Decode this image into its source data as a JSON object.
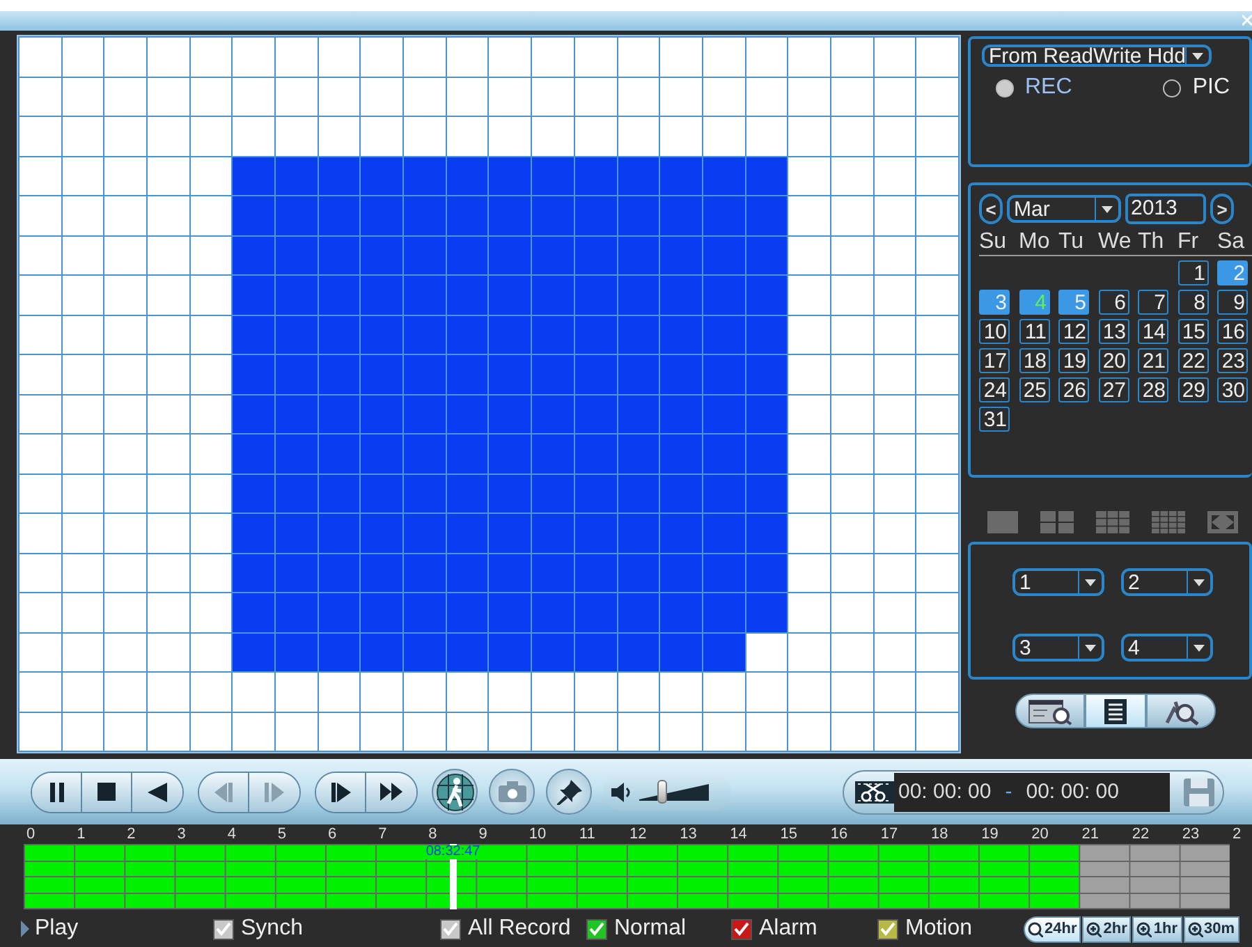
{
  "grid": {
    "rows": [
      {
        "selected": [
          false,
          false,
          false,
          false,
          false,
          false,
          false,
          false,
          false,
          false,
          false,
          false,
          false,
          false,
          false,
          false,
          false,
          false,
          false,
          false,
          false,
          false
        ]
      },
      {
        "selected": [
          false,
          false,
          false,
          false,
          false,
          false,
          false,
          false,
          false,
          false,
          false,
          false,
          false,
          false,
          false,
          false,
          false,
          false,
          false,
          false,
          false,
          false
        ]
      },
      {
        "selected": [
          false,
          false,
          false,
          false,
          false,
          false,
          false,
          false,
          false,
          false,
          false,
          false,
          false,
          false,
          false,
          false,
          false,
          false,
          false,
          false,
          false,
          false
        ]
      },
      {
        "selected": [
          false,
          false,
          false,
          false,
          false,
          true,
          true,
          true,
          true,
          true,
          true,
          true,
          true,
          true,
          true,
          true,
          true,
          true,
          false,
          false,
          false,
          false
        ]
      },
      {
        "selected": [
          false,
          false,
          false,
          false,
          false,
          true,
          true,
          true,
          true,
          true,
          true,
          true,
          true,
          true,
          true,
          true,
          true,
          true,
          false,
          false,
          false,
          false
        ]
      },
      {
        "selected": [
          false,
          false,
          false,
          false,
          false,
          true,
          true,
          true,
          true,
          true,
          true,
          true,
          true,
          true,
          true,
          true,
          true,
          true,
          false,
          false,
          false,
          false
        ]
      },
      {
        "selected": [
          false,
          false,
          false,
          false,
          false,
          true,
          true,
          true,
          true,
          true,
          true,
          true,
          true,
          true,
          true,
          true,
          true,
          true,
          false,
          false,
          false,
          false
        ]
      },
      {
        "selected": [
          false,
          false,
          false,
          false,
          false,
          true,
          true,
          true,
          true,
          true,
          true,
          true,
          true,
          true,
          true,
          true,
          true,
          true,
          false,
          false,
          false,
          false
        ]
      },
      {
        "selected": [
          false,
          false,
          false,
          false,
          false,
          true,
          true,
          true,
          true,
          true,
          true,
          true,
          true,
          true,
          true,
          true,
          true,
          true,
          false,
          false,
          false,
          false
        ]
      },
      {
        "selected": [
          false,
          false,
          false,
          false,
          false,
          true,
          true,
          true,
          true,
          true,
          true,
          true,
          true,
          true,
          true,
          true,
          true,
          true,
          false,
          false,
          false,
          false
        ]
      },
      {
        "selected": [
          false,
          false,
          false,
          false,
          false,
          true,
          true,
          true,
          true,
          true,
          true,
          true,
          true,
          true,
          true,
          true,
          true,
          true,
          false,
          false,
          false,
          false
        ]
      },
      {
        "selected": [
          false,
          false,
          false,
          false,
          false,
          true,
          true,
          true,
          true,
          true,
          true,
          true,
          true,
          true,
          true,
          true,
          true,
          true,
          false,
          false,
          false,
          false
        ]
      },
      {
        "selected": [
          false,
          false,
          false,
          false,
          false,
          true,
          true,
          true,
          true,
          true,
          true,
          true,
          true,
          true,
          true,
          true,
          true,
          true,
          false,
          false,
          false,
          false
        ]
      },
      {
        "selected": [
          false,
          false,
          false,
          false,
          false,
          true,
          true,
          true,
          true,
          true,
          true,
          true,
          true,
          true,
          true,
          true,
          true,
          true,
          false,
          false,
          false,
          false
        ]
      },
      {
        "selected": [
          false,
          false,
          false,
          false,
          false,
          true,
          true,
          true,
          true,
          true,
          true,
          true,
          true,
          true,
          true,
          true,
          true,
          true,
          false,
          false,
          false,
          false
        ]
      },
      {
        "selected": [
          false,
          false,
          false,
          false,
          false,
          true,
          true,
          true,
          true,
          true,
          true,
          true,
          true,
          true,
          true,
          true,
          true,
          false,
          false,
          false,
          false,
          false
        ]
      },
      {
        "selected": [
          false,
          false,
          false,
          false,
          false,
          false,
          false,
          false,
          false,
          false,
          false,
          false,
          false,
          false,
          false,
          false,
          false,
          false,
          false,
          false,
          false,
          false
        ]
      },
      {
        "selected": [
          false,
          false,
          false,
          false,
          false,
          false,
          false,
          false,
          false,
          false,
          false,
          false,
          false,
          false,
          false,
          false,
          false,
          false,
          false,
          false,
          false,
          false
        ]
      }
    ]
  },
  "source": {
    "dropdown": "From ReadWrite Hdd",
    "options": [
      {
        "label": "REC",
        "selected": true
      },
      {
        "label": "PIC",
        "selected": false
      }
    ]
  },
  "calendar": {
    "prev": "<",
    "month": "Mar",
    "year": "2013",
    "next": ">",
    "weekdays": [
      "Su",
      "Mo",
      "Tu",
      "We",
      "Th",
      "Fr",
      "Sa"
    ],
    "weeks": [
      [
        {
          "kind": "blank"
        },
        {
          "kind": "blank"
        },
        {
          "kind": "blank"
        },
        {
          "kind": "blank"
        },
        {
          "kind": "blank"
        },
        {
          "label": "1",
          "has_record": false,
          "today": false
        },
        {
          "label": "2",
          "has_record": true,
          "today": false
        }
      ],
      [
        {
          "label": "3",
          "has_record": true,
          "today": false
        },
        {
          "label": "4",
          "has_record": true,
          "today": true
        },
        {
          "label": "5",
          "has_record": true,
          "today": false
        },
        {
          "label": "6",
          "has_record": false,
          "today": false
        },
        {
          "label": "7",
          "has_record": false,
          "today": false
        },
        {
          "label": "8",
          "has_record": false,
          "today": false
        },
        {
          "label": "9",
          "has_record": false,
          "today": false
        }
      ],
      [
        {
          "label": "10",
          "has_record": false,
          "today": false
        },
        {
          "label": "11",
          "has_record": false,
          "today": false
        },
        {
          "label": "12",
          "has_record": false,
          "today": false
        },
        {
          "label": "13",
          "has_record": false,
          "today": false
        },
        {
          "label": "14",
          "has_record": false,
          "today": false
        },
        {
          "label": "15",
          "has_record": false,
          "today": false
        },
        {
          "label": "16",
          "has_record": false,
          "today": false
        }
      ],
      [
        {
          "label": "17",
          "has_record": false,
          "today": false
        },
        {
          "label": "18",
          "has_record": false,
          "today": false
        },
        {
          "label": "19",
          "has_record": false,
          "today": false
        },
        {
          "label": "20",
          "has_record": false,
          "today": false
        },
        {
          "label": "21",
          "has_record": false,
          "today": false
        },
        {
          "label": "22",
          "has_record": false,
          "today": false
        },
        {
          "label": "23",
          "has_record": false,
          "today": false
        }
      ],
      [
        {
          "label": "24",
          "has_record": false,
          "today": false
        },
        {
          "label": "25",
          "has_record": false,
          "today": false
        },
        {
          "label": "26",
          "has_record": false,
          "today": false
        },
        {
          "label": "27",
          "has_record": false,
          "today": false
        },
        {
          "label": "28",
          "has_record": false,
          "today": false
        },
        {
          "label": "29",
          "has_record": false,
          "today": false
        },
        {
          "label": "30",
          "has_record": false,
          "today": false
        }
      ],
      [
        {
          "label": "31",
          "has_record": false,
          "today": false
        }
      ]
    ]
  },
  "channel_selects": [
    "1",
    "2",
    "3",
    "4"
  ],
  "tool_buttons": [
    {
      "kind": "card-search",
      "selected": false
    },
    {
      "kind": "list",
      "selected": true
    },
    {
      "kind": "smart-search",
      "selected": false
    }
  ],
  "button_groups": [
    [
      {
        "kind": "pause",
        "disabled": false
      },
      {
        "kind": "stop",
        "disabled": false
      },
      {
        "kind": "reverse",
        "disabled": false
      }
    ],
    [
      {
        "kind": "step-back",
        "disabled": true
      },
      {
        "kind": "step-forward",
        "disabled": true
      }
    ],
    [
      {
        "kind": "slow-play",
        "disabled": false
      },
      {
        "kind": "fast-forward",
        "disabled": false
      }
    ]
  ],
  "round_buttons": [
    {
      "kind": "person-grid"
    },
    {
      "kind": "camera"
    },
    {
      "kind": "pin"
    }
  ],
  "volume": {
    "level": 0.32
  },
  "clip": {
    "start": "00: 00: 00",
    "separator": "-",
    "end": "00: 00: 00"
  },
  "timeline": {
    "hours": [
      "0",
      "1",
      "2",
      "3",
      "4",
      "5",
      "6",
      "7",
      "8",
      "9",
      "10",
      "11",
      "12",
      "13",
      "14",
      "15",
      "16",
      "17",
      "18",
      "19",
      "20",
      "21",
      "22",
      "23",
      "2"
    ],
    "playhead": {
      "time": "08:32:47",
      "level": 0.356
    },
    "channels": [
      {
        "level": 0.875
      },
      {
        "level": 0.875
      },
      {
        "level": 0.875
      },
      {
        "level": 0.875
      }
    ]
  },
  "play": "Play",
  "synch": {
    "label": "Synch",
    "checked": true
  },
  "legend": [
    {
      "label": "All Record",
      "checked": true,
      "color": "#c8c8c8"
    },
    {
      "label": "Normal",
      "checked": true,
      "color": "#22c422"
    },
    {
      "label": "Alarm",
      "checked": true,
      "color": "#c81818"
    },
    {
      "label": "Motion",
      "checked": true,
      "color": "#b8b844"
    }
  ],
  "zoom": [
    {
      "label": "24hr",
      "selected": true
    },
    {
      "label": "2hr",
      "selected": false
    },
    {
      "label": "1hr",
      "selected": false
    },
    {
      "label": "30m",
      "selected": false
    }
  ]
}
